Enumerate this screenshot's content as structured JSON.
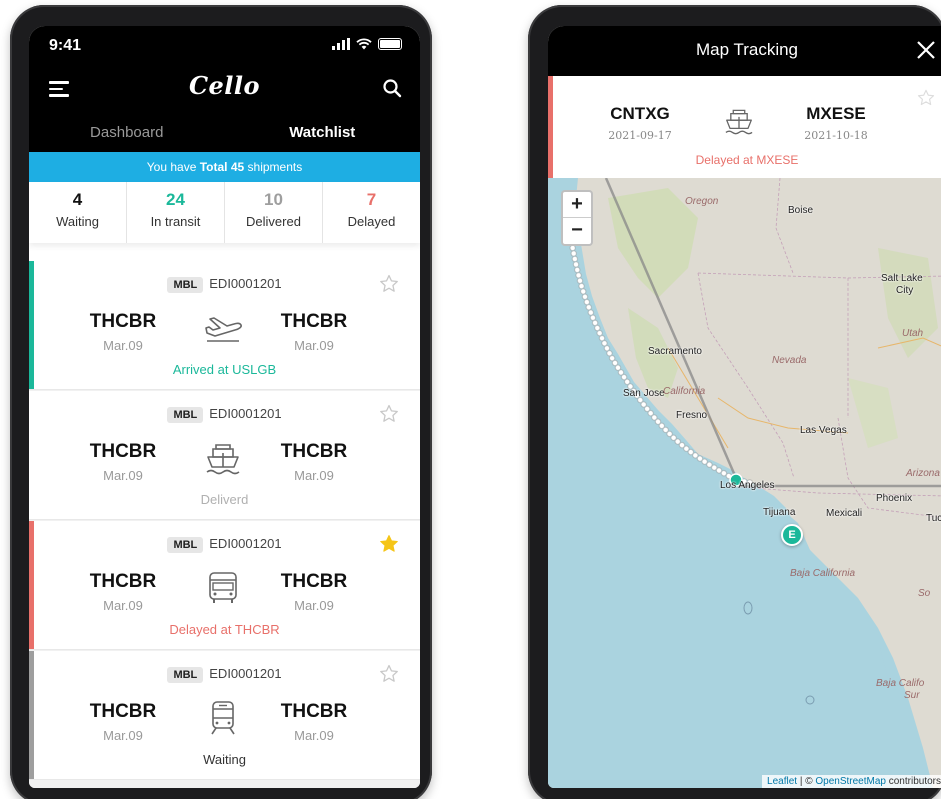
{
  "left_app": {
    "status_bar": {
      "time": "9:41"
    },
    "logo": "Cello",
    "tabs": [
      {
        "label": "Dashboard",
        "active": false
      },
      {
        "label": "Watchlist",
        "active": true
      }
    ],
    "banner": {
      "prefix": "You have ",
      "bold": "Total 45",
      "suffix": " shipments"
    },
    "counts": [
      {
        "value": "4",
        "label": "Waiting",
        "color": "#111111"
      },
      {
        "value": "24",
        "label": "In transit",
        "color": "#1bb89a"
      },
      {
        "value": "10",
        "label": "Delivered",
        "color": "#9e9e9e"
      },
      {
        "value": "7",
        "label": "Delayed",
        "color": "#e8706a"
      }
    ],
    "shipments": [
      {
        "tag": "MBL",
        "number": "EDI0001201",
        "from": "THCBR",
        "from_date": "Mar.09",
        "to": "THCBR",
        "to_date": "Mar.09",
        "mode": "plane-icon",
        "status": "Arrived at USLGB",
        "status_color": "#1bb89a",
        "bar_color": "#1bb89a",
        "starred": false
      },
      {
        "tag": "MBL",
        "number": "EDI0001201",
        "from": "THCBR",
        "from_date": "Mar.09",
        "to": "THCBR",
        "to_date": "Mar.09",
        "mode": "ship-icon",
        "status": "Deliverd",
        "status_color": "#b0b0b0",
        "bar_color": "#ffffff",
        "starred": false
      },
      {
        "tag": "MBL",
        "number": "EDI0001201",
        "from": "THCBR",
        "from_date": "Mar.09",
        "to": "THCBR",
        "to_date": "Mar.09",
        "mode": "truck-icon",
        "status": "Delayed at THCBR",
        "status_color": "#e8706a",
        "bar_color": "#e8706a",
        "starred": true
      },
      {
        "tag": "MBL",
        "number": "EDI0001201",
        "from": "THCBR",
        "from_date": "Mar.09",
        "to": "THCBR",
        "to_date": "Mar.09",
        "mode": "train-icon",
        "status": "Waiting",
        "status_color": "#333333",
        "bar_color": "#9e9e9e",
        "starred": false
      }
    ]
  },
  "right_app": {
    "title": "Map Tracking",
    "route": {
      "from": "CNTXG",
      "from_date": "2021-09-17",
      "to": "MXESE",
      "to_date": "2021-10-18",
      "status": "Delayed at MXESE"
    },
    "map": {
      "zoom_in": "+",
      "zoom_out": "−",
      "end_marker": "E",
      "labels": {
        "oregon": "Oregon",
        "boise": "Boise",
        "salt_lake": "Salt Lake",
        "salt_lake_2": "City",
        "utah": "Utah",
        "nevada": "Nevada",
        "sacramento": "Sacramento",
        "san_jose": "San Jose",
        "california": "California",
        "fresno": "Fresno",
        "las_vegas": "Las Vegas",
        "arizona": "Arizona",
        "los_angeles": "Los Angeles",
        "phoenix": "Phoenix",
        "tijuana": "Tijuana",
        "mexicali": "Mexicali",
        "tucson": "Tucs",
        "baja": "Baja California",
        "baja_sur": "Baja Califo",
        "baja_sur_2": "Sur",
        "so": "So"
      },
      "attribution": {
        "leaflet": "Leaflet",
        "sep": " | © ",
        "osm": "OpenStreetMap",
        "contrib": " contributors"
      }
    }
  }
}
